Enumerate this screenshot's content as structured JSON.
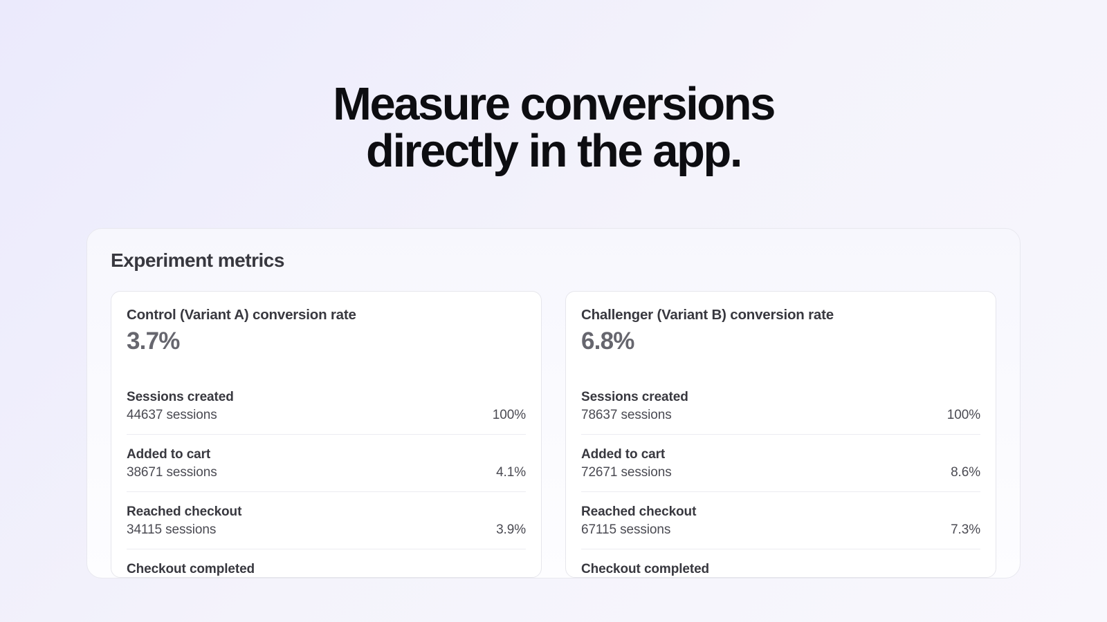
{
  "hero": {
    "line1": "Measure conversions",
    "line2": "directly in the app."
  },
  "panel": {
    "title": "Experiment metrics"
  },
  "variants": [
    {
      "title": "Control (Variant A) conversion rate",
      "rate": "3.7%",
      "steps": [
        {
          "label": "Sessions created",
          "value": "44637 sessions",
          "pct": "100%"
        },
        {
          "label": "Added to cart",
          "value": "38671 sessions",
          "pct": "4.1%"
        },
        {
          "label": "Reached checkout",
          "value": "34115 sessions",
          "pct": "3.9%"
        },
        {
          "label": "Checkout completed",
          "value": "",
          "pct": ""
        }
      ]
    },
    {
      "title": "Challenger  (Variant B)  conversion rate",
      "rate": "6.8%",
      "steps": [
        {
          "label": "Sessions created",
          "value": "78637 sessions",
          "pct": "100%"
        },
        {
          "label": "Added to cart",
          "value": "72671 sessions",
          "pct": "8.6%"
        },
        {
          "label": "Reached checkout",
          "value": "67115 sessions",
          "pct": "7.3%"
        },
        {
          "label": "Checkout completed",
          "value": "",
          "pct": ""
        }
      ]
    }
  ]
}
